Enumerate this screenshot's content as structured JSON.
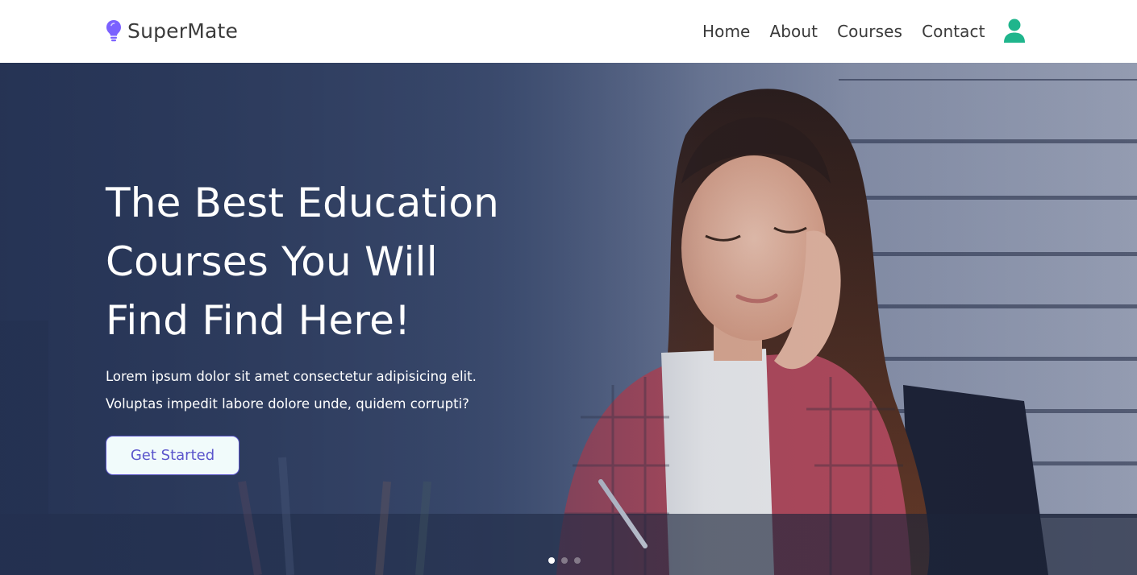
{
  "brand": {
    "name": "SuperMate",
    "icon": "lightbulb-icon",
    "icon_color": "#7b61ff"
  },
  "nav": {
    "items": [
      "Home",
      "About",
      "Courses",
      "Contact"
    ]
  },
  "user": {
    "icon": "user-icon",
    "color": "#1fb58c"
  },
  "hero": {
    "title_line1": "The Best Education",
    "title_line2": "Courses You Will",
    "title_line3": "Find Find Here!",
    "text": "Lorem ipsum dolor sit amet consectetur adipisicing elit. Voluptas impedit labore dolore unde, quidem corrupti?",
    "cta_label": "Get Started",
    "image": "girl-studying-photo",
    "carousel": {
      "count": 3,
      "active": 1
    }
  },
  "colors": {
    "accent": "#5b55cc",
    "hero_overlay": "#2c3a58",
    "user_icon": "#1fb58c",
    "brand_icon": "#7b61ff"
  }
}
